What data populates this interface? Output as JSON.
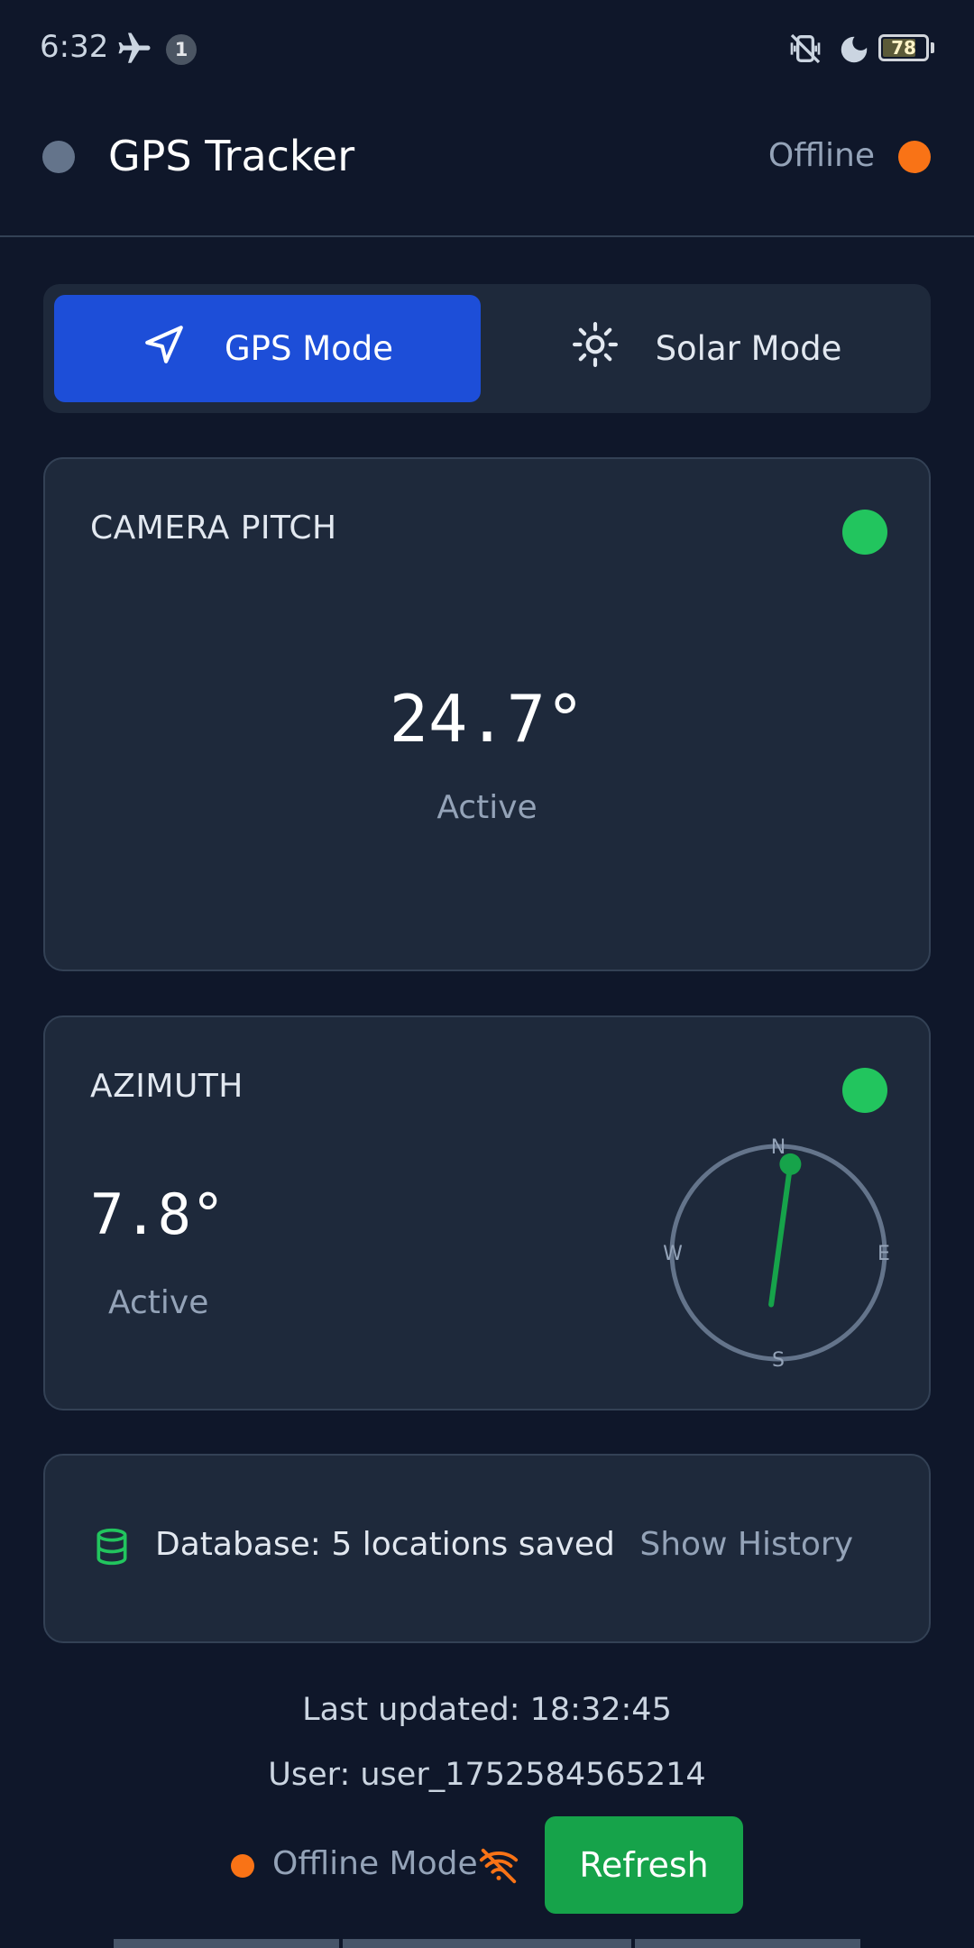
{
  "status_bar": {
    "time": "6:32",
    "notification_count": "1",
    "battery": "78",
    "battery_level": 0.78
  },
  "header": {
    "title": "GPS Tracker",
    "connection_status": "Offline",
    "status_color": "#f97316"
  },
  "mode_toggle": {
    "gps_label": "GPS Mode",
    "solar_label": "Solar Mode",
    "selected": "GPS Mode"
  },
  "camera_pitch": {
    "title": "CAMERA PITCH",
    "value": "24.7°",
    "status": "Active",
    "indicator_color": "#22c55e"
  },
  "azimuth": {
    "title": "AZIMUTH",
    "value": "7.8°",
    "status": "Active",
    "heading_degrees": 7.8,
    "compass_labels": {
      "n": "N",
      "e": "E",
      "s": "S",
      "w": "W"
    }
  },
  "database": {
    "text": "Database: 5 locations saved",
    "history_label": "Show History"
  },
  "footer": {
    "last_updated": "Last updated: 18:32:45",
    "user": "User: user_1752584565214",
    "offline_mode": "Offline Mode",
    "refresh_label": "Refresh"
  },
  "colors": {
    "background": "#0f172a",
    "card": "#1e293b",
    "accent_blue": "#1d4ed8",
    "active_green": "#22c55e",
    "offline_orange": "#f97316",
    "refresh_green": "#16a34a"
  },
  "icons": {
    "gps_mode": "navigation-arrow-icon",
    "solar_mode": "sun-icon",
    "database": "database-icon",
    "offline": "wifi-off-icon"
  }
}
